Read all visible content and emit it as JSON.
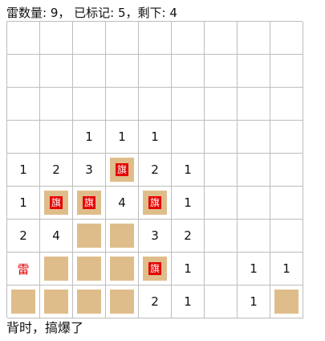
{
  "status_text": "雷数量: 9， 已标记: 5，剩下: 4",
  "message": "背时，搞爆了",
  "flag_label": "旗",
  "mine_label": "雷",
  "colors": {
    "tile": "#dfbd8b",
    "flag": "#e60000",
    "mine_text": "#e00000",
    "grid_line": "#bdbdbd"
  },
  "board": {
    "rows": 9,
    "cols": 9,
    "cells": [
      [
        "",
        "",
        "",
        "",
        "",
        "",
        "",
        "",
        ""
      ],
      [
        "",
        "",
        "",
        "",
        "",
        "",
        "",
        "",
        ""
      ],
      [
        "",
        "",
        "",
        "",
        "",
        "",
        "",
        "",
        ""
      ],
      [
        "",
        "",
        "1",
        "1",
        "1",
        "",
        "",
        "",
        ""
      ],
      [
        "1",
        "2",
        "3",
        "F",
        "2",
        "1",
        "",
        "",
        ""
      ],
      [
        "1",
        "F",
        "F",
        "4",
        "F",
        "1",
        "",
        "",
        ""
      ],
      [
        "2",
        "4",
        "C",
        "C",
        "3",
        "2",
        "",
        "",
        ""
      ],
      [
        "M",
        "C",
        "C",
        "C",
        "F",
        "1",
        "",
        "1",
        "1"
      ],
      [
        "C",
        "C",
        "C",
        "C",
        "2",
        "1",
        "",
        "1",
        "C"
      ]
    ]
  }
}
